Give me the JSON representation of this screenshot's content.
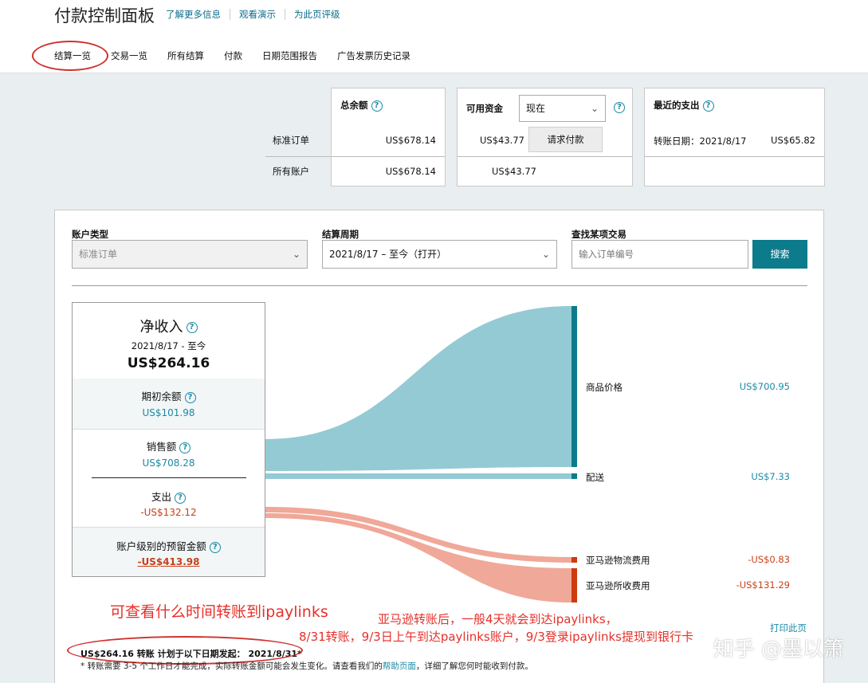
{
  "header": {
    "title": "付款控制面板",
    "links": [
      "了解更多信息",
      "观看演示",
      "为此页评级"
    ]
  },
  "tabs": [
    "结算一览",
    "交易一览",
    "所有结算",
    "付款",
    "日期范围报告",
    "广告发票历史记录"
  ],
  "summary": {
    "row_labels": [
      "标准订单",
      "所有账户"
    ],
    "total_balance": {
      "title": "总余额",
      "standard": "US$678.14",
      "all": "US$678.14"
    },
    "available": {
      "title": "可用资金",
      "select_value": "现在",
      "standard": "US$43.77",
      "all": "US$43.77",
      "request_button": "请求付款"
    },
    "recent": {
      "title": "最近的支出",
      "date_label": "转账日期：2021/8/17",
      "amount": "US$65.82"
    }
  },
  "filters": {
    "account_type_label": "账户类型",
    "account_type_value": "标准订单",
    "period_label": "结算周期",
    "period_value": "2021/8/17 – 至今（打开）",
    "find_label": "查找某项交易",
    "find_placeholder": "输入订单编号",
    "search_button": "搜索"
  },
  "net": {
    "title": "净收入",
    "range": "2021/8/17 - 至今",
    "amount": "US$264.16",
    "opening_label": "期初余额",
    "opening_value": "US$101.98",
    "sales_label": "销售额",
    "sales_value": "US$708.28",
    "expense_label": "支出",
    "expense_value": "-US$132.12",
    "reserve_label": "账户级别的预留金额",
    "reserve_value": "-US$413.98"
  },
  "flows": {
    "product_label": "商品价格",
    "product_value": "US$700.95",
    "shipping_label": "配送",
    "shipping_value": "US$7.33",
    "logistics_label": "亚马逊物流费用",
    "logistics_value": "-US$0.83",
    "fees_label": "亚马逊所收费用",
    "fees_value": "-US$131.29",
    "colors": {
      "income": "#94cad4",
      "expense": "#f0a898",
      "income_bar": "#0d7a8c",
      "expense_bar": "#cc3a0e"
    }
  },
  "footer": {
    "print": "打印此页",
    "transfer_note": "US$264.16 转账 计划于以下日期发起： 2021/8/31*",
    "disclaimer_pre": "* 转账需要 3-5 个工作日才能完成，实际转账金额可能会发生变化。请查看我们的",
    "disclaimer_link": "帮助页面",
    "disclaimer_post": "，详细了解您何时能收到付款。"
  },
  "annotations": {
    "a1": "可查看什么时间转账到ipaylinks",
    "a2": "亚马逊转账后，一般4天就会到达ipaylinks，",
    "a3": "8/31转账，9/3日上午到达paylinks账户，9/3登录ipaylinks提现到银行卡",
    "watermark": "知乎 @墨以箫"
  }
}
